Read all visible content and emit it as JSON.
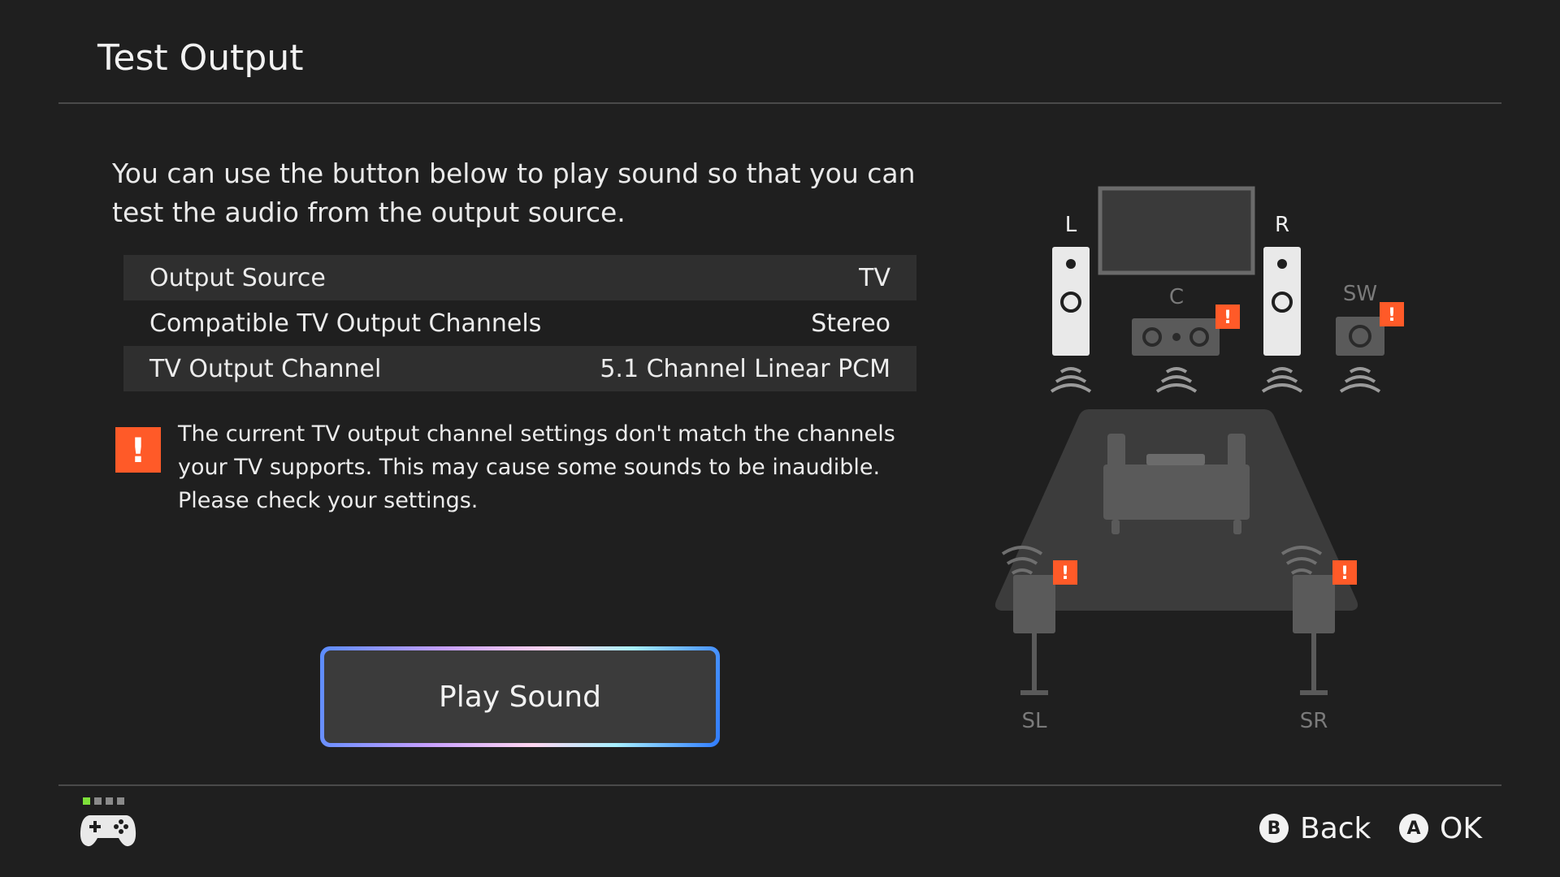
{
  "header": {
    "title": "Test Output"
  },
  "intro_text": "You can use the button below to play sound so that you can test the audio from the output source.",
  "settings": [
    {
      "label": "Output Source",
      "value": "TV"
    },
    {
      "label": "Compatible TV Output Channels",
      "value": "Stereo"
    },
    {
      "label": "TV Output Channel",
      "value": "5.1 Channel Linear PCM"
    }
  ],
  "warning": {
    "icon": "exclamation-icon",
    "glyph": "!",
    "text": "The current TV output channel settings don't match the channels your TV supports. This may cause some sounds to be inaudible. Please check your settings."
  },
  "play_button": {
    "label": "Play Sound"
  },
  "speakers": {
    "left": "L",
    "right": "R",
    "center": "C",
    "subwoofer": "SW",
    "surround_left": "SL",
    "surround_right": "SR"
  },
  "footer": {
    "controller_icon": "gamepad-icon",
    "player_indicator_active_color": "#7ee03a",
    "back": {
      "glyph": "B",
      "label": "Back"
    },
    "ok": {
      "glyph": "A",
      "label": "OK"
    }
  },
  "colors": {
    "background": "#1f1f1f",
    "warning": "#ff5a28",
    "row_shade": "#2f2f2f"
  }
}
